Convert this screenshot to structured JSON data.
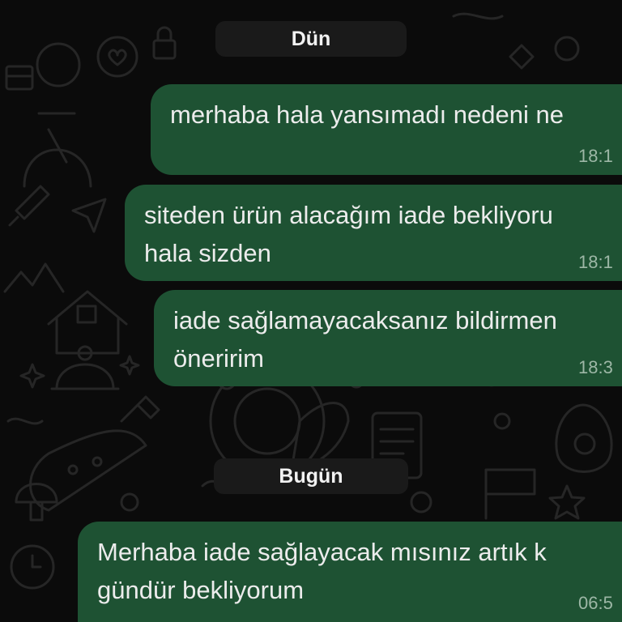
{
  "chat": {
    "days": [
      {
        "label": "Dün",
        "messages": [
          {
            "lines": "merhaba hala yansımadı nedeni ne",
            "time": "18:1"
          },
          {
            "lines": "siteden ürün alacağım iade bekliyoru\nhala sizden",
            "time": "18:1"
          },
          {
            "lines": "iade sağlamayacaksanız bildirmen\nöneririm",
            "time": "18:3"
          }
        ]
      },
      {
        "label": "Bugün",
        "messages": [
          {
            "lines": "Merhaba iade sağlayacak mısınız artık k\ngündür bekliyorum",
            "time": "06:5"
          }
        ]
      }
    ]
  },
  "colors": {
    "background": "#0b0b0b",
    "bubble_outgoing": "#1e5233",
    "date_pill": "#1a1a1a",
    "wallpaper_doodle": "#262626"
  }
}
